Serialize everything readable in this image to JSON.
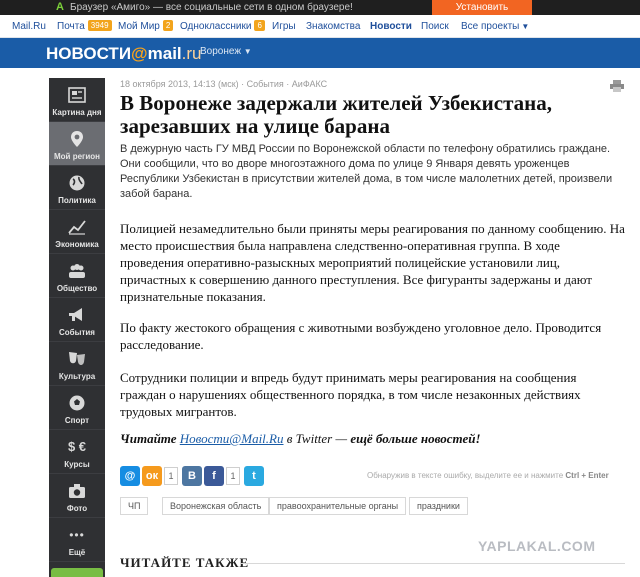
{
  "promo": {
    "logo": "A",
    "text": "Браузер «Амиго» — все социальные сети в одном браузере!",
    "install_label": "Установить"
  },
  "portal_nav": {
    "mailru": "Mail.Ru",
    "pochta": "Почта",
    "pochta_count": "3949",
    "moymir": "Мой Мир",
    "moymir_count": "2",
    "ok": "Одноклассники",
    "ok_count": "6",
    "games": "Игры",
    "dating": "Знакомства",
    "news": "Новости",
    "search": "Поиск",
    "all_projects": "Все проекты"
  },
  "news_header": {
    "brand_prefix": "НОВОСТИ",
    "brand_at": "@",
    "brand_mail": "mail",
    "brand_ru": ".ru",
    "region": "Воронеж"
  },
  "sidebar": {
    "items": [
      {
        "label": "Картина дня",
        "icon": "newspaper-icon"
      },
      {
        "label": "Мой регион",
        "icon": "map-pin-icon"
      },
      {
        "label": "Политика",
        "icon": "globe-icon"
      },
      {
        "label": "Экономика",
        "icon": "chart-icon"
      },
      {
        "label": "Общество",
        "icon": "people-icon"
      },
      {
        "label": "События",
        "icon": "megaphone-icon"
      },
      {
        "label": "Культура",
        "icon": "theater-masks-icon"
      },
      {
        "label": "Спорт",
        "icon": "soccer-ball-icon"
      },
      {
        "label": "Курсы",
        "icon": "currency-icon"
      },
      {
        "label": "Фото",
        "icon": "camera-icon"
      },
      {
        "label": "Ещё",
        "icon": "more-dots-icon"
      }
    ],
    "courses_symbols": "$ €",
    "more_symbol": "•••"
  },
  "article": {
    "meta": "18 октября 2013, 14:13 (мск) · События · АиФАКС",
    "title": "В Воронеже задержали жителей Узбекистана, зарезавших на улице барана",
    "lead": "В дежурную часть ГУ МВД России по Воронежской области по телефону обратились граждане. Они сообщили, что во дворе многоэтажного дома по улице 9 Января девять уроженцев Республики Узбекистан в присутствии жителей дома, в том числе малолетних детей, произвели забой барана.",
    "paragraphs": [
      "Полицией незамедлительно были приняты меры реагирования по данному сообщению. На место происшествия была направлена следственно-оперативная группа. В ходе проведения оперативно-разыскных мероприятий полицейские установили лиц, причастных к совершению данного преступления. Все фигуранты задержаны и дают признательные показания.",
      "По факту жестокого обращения с животными возбуждено уголовное дело. Проводится расследование.",
      "Сотрудники полиции и впредь будут принимать меры реагирования на сообщения граждан о нарушениях общественного порядка, в том числе незаконных действиях трудовых мигрантов."
    ],
    "twitter": {
      "prefix": "Читайте",
      "link": "Новости@Mail.Ru",
      "middle": "в Twitter —",
      "suffix": "ещё больше новостей!"
    }
  },
  "share": {
    "mailru_icon": "@",
    "ok_icon": "ок",
    "ok_count": "1",
    "vk_icon": "В",
    "fb_icon": "f",
    "fb_count": "1",
    "twitter_icon": "t"
  },
  "report": {
    "text": "Обнаружив в тексте ошибку, выделите ее и нажмите",
    "keys": "Ctrl + Enter"
  },
  "tags": [
    "ЧП",
    "Воронежская область",
    "правоохранительные органы",
    "праздники"
  ],
  "read_also": "ЧИТАЙТЕ ТАКЖЕ",
  "watermark": "YAPLAKAL.COM",
  "colors": {
    "news_header": "#1a5ca7",
    "sidebar": "#2f3033",
    "install_button": "#f26522",
    "sidebar_bottom_tab": "#78bd44"
  }
}
